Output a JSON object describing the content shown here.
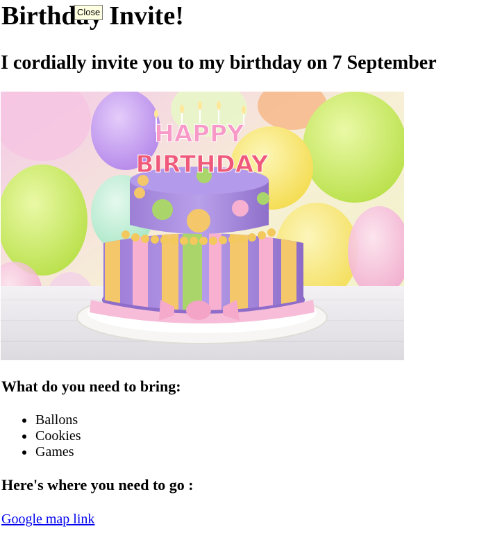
{
  "heading": {
    "title": "Birthday Invite!",
    "subtitle": "I cordially invite you to my birthday on 7 September"
  },
  "tooltip": {
    "text": "Close"
  },
  "image": {
    "cake_top_text": "HAPPY",
    "cake_bottom_text": "BIRTHDAY"
  },
  "bring": {
    "heading": "What do you need to bring:",
    "items": [
      "Ballons",
      "Cookies",
      "Games"
    ]
  },
  "location": {
    "heading": "Here's where you need to go :",
    "link_text": "Google map link"
  },
  "colors": {
    "link": "#0000ee",
    "tooltip_bg": "#ffffe1"
  }
}
